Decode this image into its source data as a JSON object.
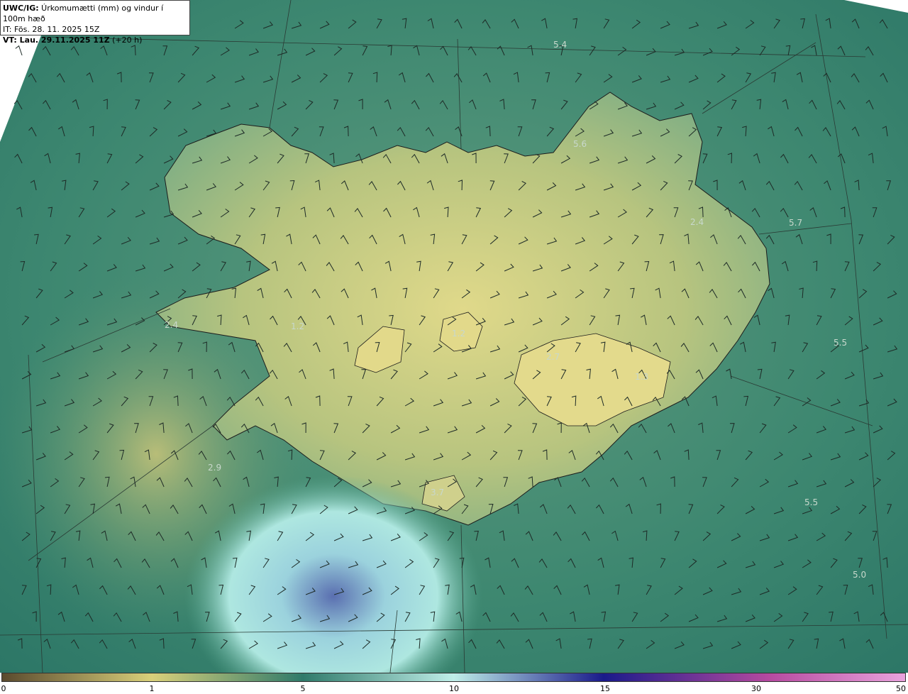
{
  "info": {
    "line1_bold": "UWC/IG:",
    "line1_rest": " Úrkomumætti (mm) og vindur í 100m hæð",
    "line2": "IT: Fös. 28. 11. 2025 15Z",
    "line3_bold": "VT: Lau. 29.11.2025 11Z",
    "line3_rest": " (+20 h)"
  },
  "value_labels": [
    "5.4",
    "5.6",
    "5.7",
    "2.4",
    "5.5",
    "1.2",
    "3.7",
    "5.5",
    "5.0",
    "2.9",
    "2.4",
    "1.2",
    "1.3",
    "2.7"
  ],
  "colorbar": {
    "ticks": [
      "0",
      "1",
      "5",
      "10",
      "15",
      "30",
      "50"
    ],
    "colors": [
      "#5a4a2e",
      "#d9d07a",
      "#2f7a6a",
      "#bfeee8",
      "#1a1a8a",
      "#b64aa0",
      "#e9a3dd"
    ]
  }
}
